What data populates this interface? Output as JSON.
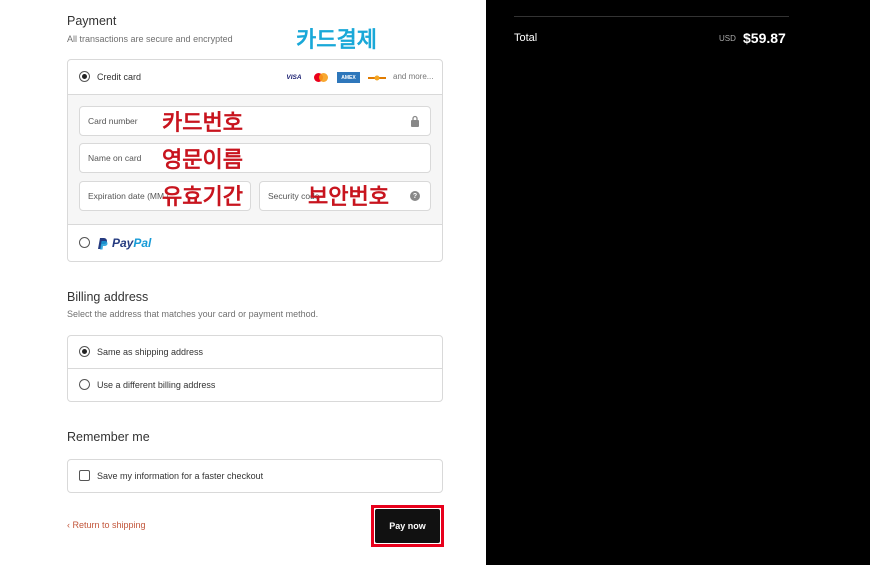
{
  "payment": {
    "title": "Payment",
    "subtitle": "All transactions are secure and encrypted",
    "annotation": "카드결제",
    "credit_card": {
      "label": "Credit card",
      "selected": true,
      "logos": [
        "VISA",
        "mastercard",
        "AMEX",
        "discover"
      ],
      "and_more": "and more...",
      "fields": {
        "card_number": "Card number",
        "name_on_card": "Name on card",
        "expiration": "Expiration date (MM / YY)",
        "security_code": "Security code"
      },
      "annotations": {
        "card_number": "카드번호",
        "name_on_card": "영문이름",
        "expiration": "유효기간",
        "security_code": "보안번호"
      }
    },
    "paypal": {
      "label_a": "Pay",
      "label_b": "Pal",
      "selected": false
    }
  },
  "billing": {
    "title": "Billing address",
    "subtitle": "Select the address that matches your card or payment method.",
    "options": [
      {
        "label": "Same as shipping address",
        "selected": true
      },
      {
        "label": "Use a different billing address",
        "selected": false
      }
    ]
  },
  "remember": {
    "title": "Remember me",
    "checkbox_label": "Save my information for a faster checkout",
    "checked": false
  },
  "footer": {
    "return_link": "‹ Return to shipping",
    "pay_button": "Pay now"
  },
  "summary": {
    "shipping_value_partial": "",
    "total_label": "Total",
    "currency": "USD",
    "total_value": "$59.87"
  },
  "colors": {
    "accent_link": "#c2563b",
    "annotation_blue": "#19a8d8",
    "annotation_red": "#c8141e",
    "highlight_outline": "#e8001c"
  },
  "icons": [
    "lock-icon",
    "help-icon",
    "paypal-logo"
  ]
}
